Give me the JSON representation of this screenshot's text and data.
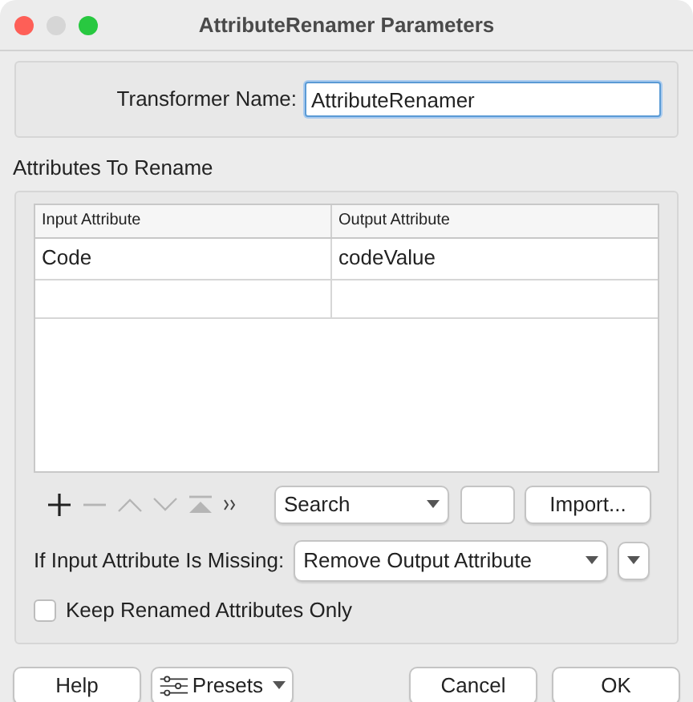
{
  "window": {
    "title": "AttributeRenamer Parameters"
  },
  "transformer_name": {
    "label": "Transformer Name:",
    "value": "AttributeRenamer"
  },
  "attributes_section": {
    "title": "Attributes To Rename"
  },
  "table": {
    "columns": [
      "Input Attribute",
      "Output Attribute"
    ],
    "rows": [
      [
        "Code",
        "codeValue"
      ]
    ]
  },
  "toolbar": {
    "tools": [
      {
        "kind": "add",
        "disabled": false
      },
      {
        "kind": "remove",
        "disabled": true
      },
      {
        "kind": "up",
        "disabled": true
      },
      {
        "kind": "down",
        "disabled": true
      },
      {
        "kind": "top",
        "disabled": true
      },
      {
        "kind": "more",
        "disabled": false
      }
    ],
    "search": {
      "value": "Search"
    },
    "import_button": "Import..."
  },
  "missing": {
    "label": "If Input Attribute Is Missing:",
    "value": "Remove Output Attribute"
  },
  "keep_only": {
    "label": "Keep Renamed Attributes Only",
    "checked": false
  },
  "buttons": {
    "help": "Help",
    "presets": "Presets",
    "cancel": "Cancel",
    "ok": "OK"
  }
}
